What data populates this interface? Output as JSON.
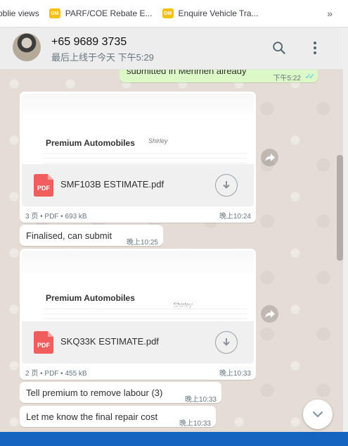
{
  "bookmarks": {
    "items": [
      {
        "label": "oblie views"
      },
      {
        "label": "PARF/COE Rebate E..."
      },
      {
        "label": "Enquire Vehicle Tra..."
      }
    ],
    "more": "»"
  },
  "header": {
    "contact_name": "+65 9689 3735",
    "status": "最后上线于今天 下午5:29"
  },
  "messages": {
    "sent_partial": {
      "text": "submitted in Merimen already",
      "time": "下午5:22"
    },
    "doc1": {
      "company": "Premium Automobiles",
      "signature": "Shirley",
      "filename": "SMF103B ESTIMATE.pdf",
      "meta": "3 页 • PDF • 693 kB",
      "time": "晚上10:24"
    },
    "msg1": {
      "text": "Finalised, can submit",
      "time": "晚上10:25"
    },
    "doc2": {
      "company": "Premium Automobiles",
      "signature": "Shirley",
      "filename": "SKQ33K ESTIMATE.pdf",
      "meta": "2 页 • PDF • 455 kB",
      "time": "晚上10:33"
    },
    "msg2": {
      "text": "Tell premium to remove labour (3)",
      "time": "晚上10:33"
    },
    "msg3": {
      "text": "Let me know the final repair cost",
      "time": "晚上10:33"
    }
  },
  "icons": {
    "pdf_label": "PDF",
    "colors": {
      "pdf": "#f15c5c",
      "outgoing": "#dcf8c6",
      "ticks": "#4fc3f7",
      "bg": "#e5ddd5"
    }
  }
}
